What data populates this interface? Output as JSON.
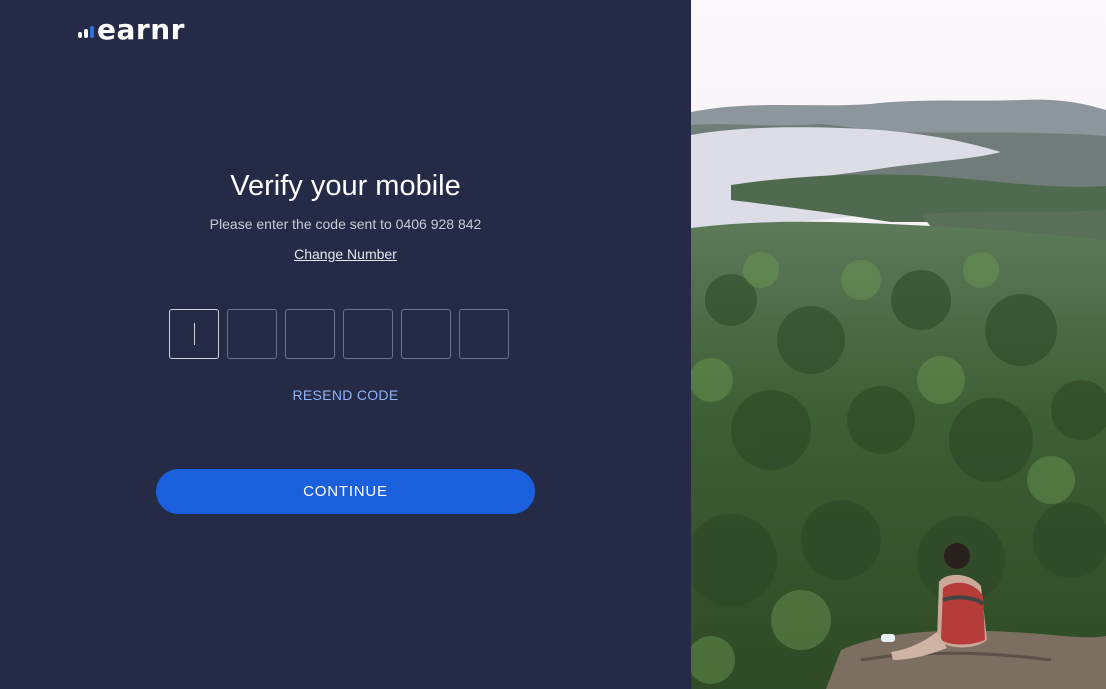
{
  "brand": {
    "logo_text": "earnr"
  },
  "heading": {
    "title": "Verify your mobile",
    "subtitle": "Please enter the code sent to 0406 928 842",
    "change_link": "Change Number"
  },
  "otp": {
    "length": 6,
    "values": [
      "",
      "",
      "",
      "",
      "",
      ""
    ],
    "active_index": 0
  },
  "actions": {
    "resend_label": "RESEND CODE",
    "continue_label": "CONTINUE"
  },
  "colors": {
    "panel_bg": "#252a47",
    "accent": "#1a5fdc",
    "link": "#8eb4f3"
  },
  "image": {
    "subject": "hiker-overlooking-lake-forest"
  }
}
